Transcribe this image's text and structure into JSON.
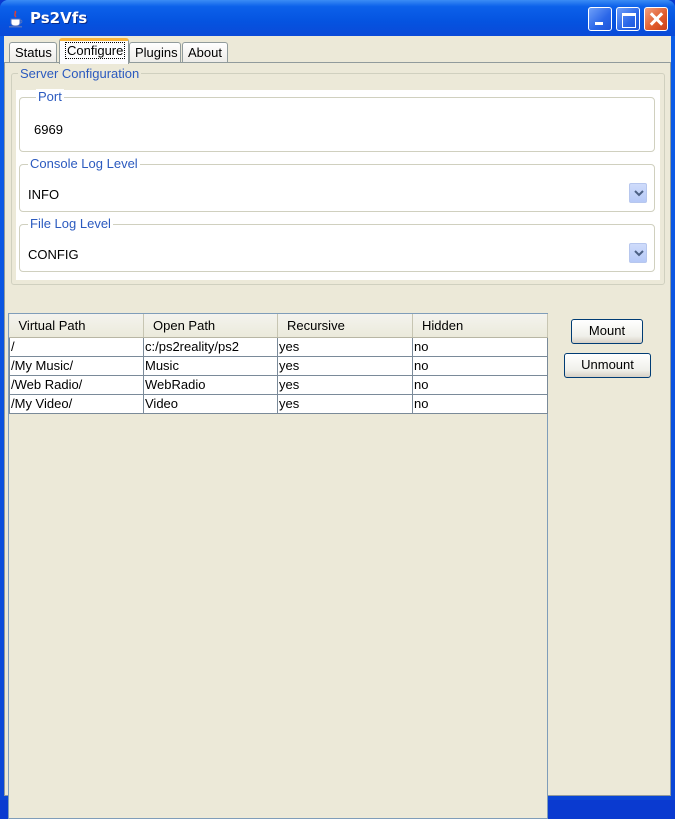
{
  "window": {
    "title": "Ps2Vfs",
    "icon": "java-cup-icon",
    "controls": [
      "minimize",
      "maximize",
      "close"
    ]
  },
  "tabs": [
    {
      "label": "Status",
      "active": false
    },
    {
      "label": "Configure",
      "active": true
    },
    {
      "label": "Plugins",
      "active": false
    },
    {
      "label": "About",
      "active": false
    }
  ],
  "server_config": {
    "title": "Server Configuration",
    "port": {
      "label": "Port",
      "value": "6969"
    },
    "console_log_level": {
      "label": "Console Log Level",
      "value": "INFO"
    },
    "file_log_level": {
      "label": "File Log Level",
      "value": "CONFIG"
    }
  },
  "table": {
    "columns": [
      "Virtual Path",
      "Open Path",
      "Recursive",
      "Hidden"
    ],
    "rows": [
      [
        "/",
        "c:/ps2reality/ps2",
        "yes",
        "no"
      ],
      [
        "/My Music/",
        "Music",
        "yes",
        "no"
      ],
      [
        "/Web Radio/",
        "WebRadio",
        "yes",
        "no"
      ],
      [
        "/My Video/",
        "Video",
        "yes",
        "no"
      ]
    ]
  },
  "buttons": {
    "mount": "Mount",
    "unmount": "Unmount"
  }
}
